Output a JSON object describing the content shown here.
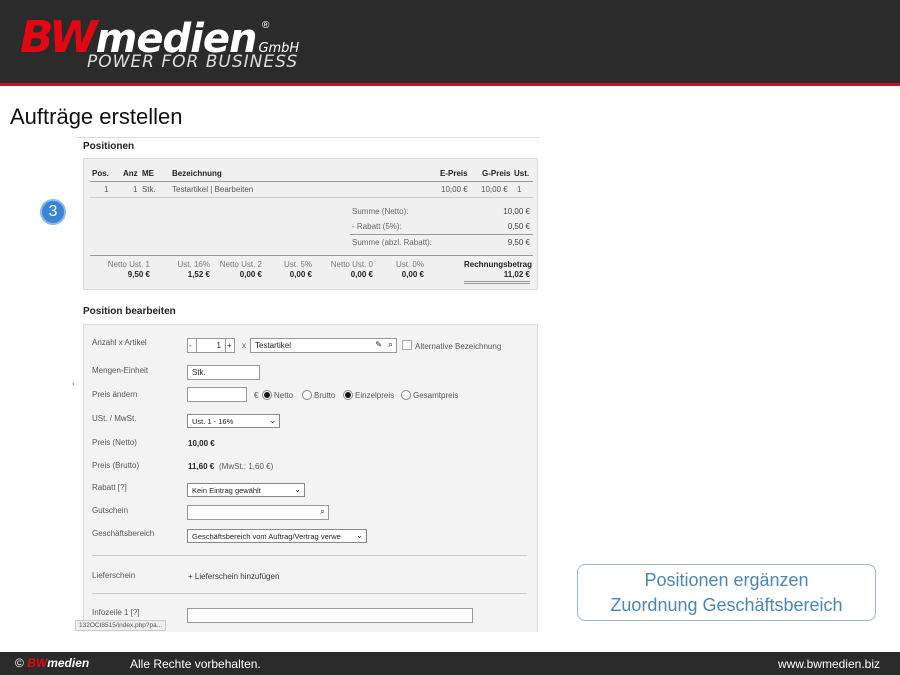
{
  "header": {
    "logo_bw": "BW",
    "logo_medien": "medien",
    "logo_gmbh": "GmbH",
    "logo_reg": "®",
    "tagline": "POWER FOR BUSINESS"
  },
  "page_title": "Aufträge erstellen",
  "step_number": "3",
  "positions": {
    "title": "Positionen",
    "columns": [
      "Pos.",
      "Anz",
      "ME",
      "Bezeichnung",
      "E-Preis",
      "G-Preis",
      "Ust."
    ],
    "rows": [
      {
        "pos": "1",
        "anz": "1",
        "me": "Stk.",
        "bezeichnung": "Testartikel | Bearbeiten",
        "epreis": "10,00 €",
        "gpreis": "10,00 €",
        "ust": "1"
      }
    ],
    "sums": [
      {
        "label": "Summe (Netto):",
        "value": "10,00 €"
      },
      {
        "label": "- Rabatt (5%):",
        "value": "0,50 €"
      },
      {
        "label": "Summe (abzl. Rabatt):",
        "value": "9,50 €"
      }
    ],
    "taxes": [
      {
        "label": "Netto Ust. 1",
        "value": "9,50 €"
      },
      {
        "label": "Ust. 16%",
        "value": "1,52 €"
      },
      {
        "label": "Netto Ust. 2",
        "value": "0,00 €"
      },
      {
        "label": "Ust. 5%",
        "value": "0,00 €"
      },
      {
        "label": "Netto Ust. 0",
        "value": "0,00 €"
      },
      {
        "label": "Ust. 0%",
        "value": "0,00 €"
      }
    ],
    "total_label": "Rechnungsbetrag",
    "total_value": "11,02 €"
  },
  "edit": {
    "title": "Position bearbeiten",
    "anzahl_label": "Anzahl x Artikel",
    "minus": "-",
    "qty": "1",
    "plus": "+",
    "times": "x",
    "artikel": "Testartikel",
    "alt_label": "Alternative Bezeichnung",
    "einheit_label": "Mengen-Einheit",
    "einheit_value": "Stk.",
    "preis_label": "Preis ändern",
    "preis_value": "",
    "currency": "€",
    "radio_netto": "Netto",
    "radio_brutto": "Brutto",
    "radio_einzel": "Einzelpreis",
    "radio_gesamt": "Gesamtpreis",
    "ust_label": "USt. / MwSt.",
    "ust_value": "Ust. 1 - 16%",
    "netto_label": "Preis (Netto)",
    "netto_value": "10,00 €",
    "brutto_label": "Preis (Brutto)",
    "brutto_value": "11,60 €",
    "brutto_mwst": "(MwSt.: 1,60 €)",
    "rabatt_label": "Rabatt [?]",
    "rabatt_value": "Kein Eintrag gewählt",
    "gutschein_label": "Gutschein",
    "gutschein_value": "",
    "gb_label": "Geschäftsbereich",
    "gb_value": "Geschäftsbereich vom Auftrag/Vertrag verwe",
    "ls_label": "Lieferschein",
    "ls_link": "+ Lieferschein hinzufügen",
    "info_label": "Infozeile 1 [?]",
    "info_value": ""
  },
  "status_url": "132OCI8515/index.php?pa...",
  "callout": {
    "line1": "Positionen ergänzen",
    "line2": "Zuordnung Geschäftsbereich"
  },
  "footer": {
    "copyright": "©",
    "logo_bw": "BW",
    "logo_medien": "medien",
    "rights": "Alle Rechte vorbehalten.",
    "website": "www.bwmedien.biz"
  },
  "colors": {
    "brand_red": "#e30613",
    "header_bg": "#2b2b2b",
    "accent_blue": "#3a86d6",
    "callout_text": "#4a86b8"
  }
}
